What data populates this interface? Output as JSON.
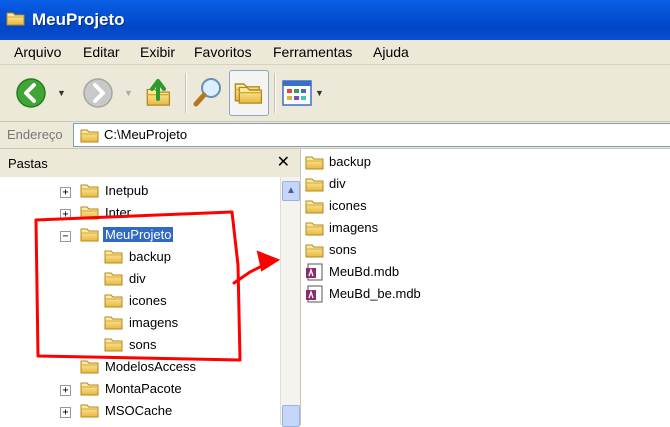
{
  "window": {
    "title": "MeuProjeto"
  },
  "menu": [
    "Arquivo",
    "Editar",
    "Exibir",
    "Favoritos",
    "Ferramentas",
    "Ajuda"
  ],
  "toolbar": {
    "buttons": [
      "back-icon",
      "forward-icon",
      "up-folder-icon",
      "search-icon",
      "folders-icon",
      "views-icon"
    ]
  },
  "address": {
    "label": "Endereço",
    "value": "C:\\MeuProjeto"
  },
  "folders_pane": {
    "title": "Pastas",
    "close": "✕",
    "tree": [
      {
        "label": "Inetpub",
        "expander": "+"
      },
      {
        "label": "Inter",
        "expander": "+"
      },
      {
        "label": "MeuProjeto",
        "expander": "−",
        "selected": true
      },
      {
        "label": "backup"
      },
      {
        "label": "div"
      },
      {
        "label": "icones"
      },
      {
        "label": "imagens"
      },
      {
        "label": "sons"
      },
      {
        "label": "ModelosAccess"
      },
      {
        "label": "MontaPacote",
        "expander": "+"
      },
      {
        "label": "MSOCache",
        "expander": "+"
      }
    ]
  },
  "files": [
    {
      "name": "backup",
      "icon": "folder-icon"
    },
    {
      "name": "div",
      "icon": "folder-icon"
    },
    {
      "name": "icones",
      "icon": "folder-icon"
    },
    {
      "name": "imagens",
      "icon": "folder-icon"
    },
    {
      "name": "sons",
      "icon": "folder-icon"
    },
    {
      "name": "MeuBd.mdb",
      "icon": "access-db-icon"
    },
    {
      "name": "MeuBd_be.mdb",
      "icon": "access-db-icon"
    }
  ],
  "colors": {
    "titlebar": "#0054e3",
    "selection": "#316ac5",
    "annotation": "#ff0000"
  }
}
